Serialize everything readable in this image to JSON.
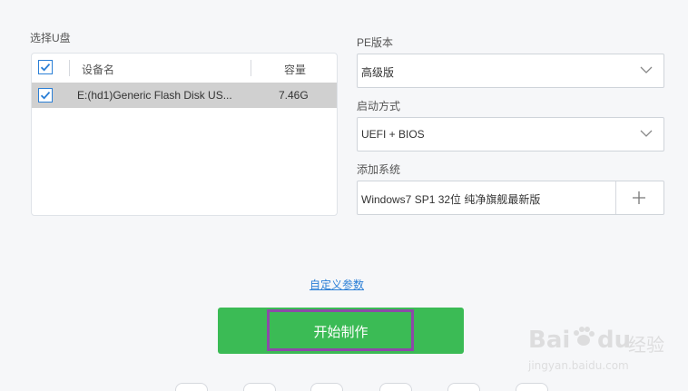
{
  "left_panel": {
    "title": "选择U盘",
    "columns": {
      "device": "设备名",
      "capacity": "容量"
    },
    "rows": [
      {
        "device": "E:(hd1)Generic Flash Disk US...",
        "capacity": "7.46G",
        "checked": true
      }
    ],
    "header_checked": true
  },
  "right_panel": {
    "pe_version": {
      "label": "PE版本",
      "value": "高级版"
    },
    "boot_mode": {
      "label": "启动方式",
      "value": "UEFI + BIOS"
    },
    "add_system": {
      "label": "添加系统",
      "value": "Windows7 SP1 32位 纯净旗舰最新版"
    }
  },
  "custom_params_link": "自定义参数",
  "start_button": "开始制作",
  "watermark": {
    "brand": "Bai",
    "brand2": "du",
    "cn": "经验",
    "url": "jingyan.baidu.com"
  },
  "colors": {
    "accent_blue": "#2b7fd6",
    "button_green": "#3bbb55",
    "highlight_purple": "#8c4aa8",
    "row_selected": "#d0d0d0"
  },
  "icons": {
    "check": "check-icon",
    "chevron": "chevron-down-icon",
    "plus": "plus-icon"
  }
}
